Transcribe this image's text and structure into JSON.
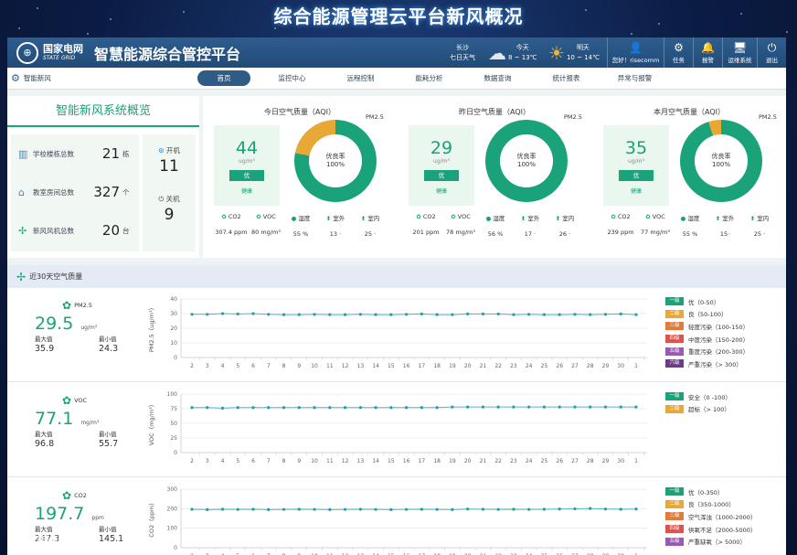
{
  "page_title": "综合能源管理云平台新风概况",
  "header": {
    "brand_cn": "国家电网",
    "brand_en": "STATE GRID",
    "app_title": "智慧能源综合管控平台",
    "city": "长沙",
    "weather_label": "七日天气",
    "today": {
      "label": "今天",
      "temp": "8 ~ 13℃"
    },
    "tomorrow": {
      "label": "明天",
      "temp": "10 ~ 14℃"
    },
    "user": "您好！risecomm",
    "tools": [
      "任务",
      "报警",
      "运维系统",
      "退出"
    ]
  },
  "nav": {
    "current": "智能新风",
    "tabs": [
      "首页",
      "监控中心",
      "远程控制",
      "能耗分析",
      "数据查询",
      "统计报表",
      "异常与报警"
    ]
  },
  "overview": {
    "title": "智能新风系统概览",
    "rows": [
      {
        "label": "学校楼栋总数",
        "value": "21",
        "unit": "栋"
      },
      {
        "label": "教室房间总数",
        "value": "327",
        "unit": "个"
      },
      {
        "label": "新风风机总数",
        "value": "20",
        "unit": "台"
      }
    ],
    "on_label": "开机",
    "on_value": "11",
    "off_label": "关机",
    "off_value": "9"
  },
  "aqi_cards": [
    {
      "title": "今日空气质量（AQI）",
      "value": "44",
      "unit": "ug/m³",
      "level": "优",
      "health": "健康",
      "pm": "PM2.5",
      "rate_label": "优良率",
      "rate": "100%",
      "donut_fraction": 0.78,
      "stats": [
        {
          "k": "CO2",
          "v": "307.4 ppm"
        },
        {
          "k": "VOC",
          "v": "80 mg/m³"
        },
        {
          "k": "湿度",
          "v": "55 %"
        },
        {
          "k": "室外",
          "v": "13 ·"
        },
        {
          "k": "室内",
          "v": "25 ·"
        }
      ]
    },
    {
      "title": "昨日空气质量（AQI）",
      "value": "29",
      "unit": "ug/m³",
      "level": "优",
      "health": "健康",
      "pm": "PM2.5",
      "rate_label": "优良率",
      "rate": "100%",
      "donut_fraction": 1.0,
      "stats": [
        {
          "k": "CO2",
          "v": "201 ppm"
        },
        {
          "k": "VOC",
          "v": "78 mg/m³"
        },
        {
          "k": "湿度",
          "v": "56 %"
        },
        {
          "k": "室外",
          "v": "17 ·"
        },
        {
          "k": "室内",
          "v": "26 ·"
        }
      ]
    },
    {
      "title": "本月空气质量（AQI）",
      "value": "35",
      "unit": "ug/m³",
      "level": "优",
      "health": "健康",
      "pm": "PM2.5",
      "rate_label": "优良率",
      "rate": "100%",
      "donut_fraction": 0.95,
      "stats": [
        {
          "k": "CO2",
          "v": "239 ppm"
        },
        {
          "k": "VOC",
          "v": "77 mg/m³"
        },
        {
          "k": "湿度",
          "v": "55 %"
        },
        {
          "k": "室外",
          "v": "15·"
        },
        {
          "k": "室内",
          "v": "25 ·"
        }
      ]
    }
  ],
  "trend_title": "近30天空气质量",
  "trends": [
    {
      "name": "PM2.5",
      "value": "29.5",
      "unit": "ug/m³",
      "max_label": "最大值",
      "max": "35.9",
      "min_label": "最小值",
      "min": "24.3",
      "legend": [
        {
          "tag": "一级",
          "text": "优（0-50）"
        },
        {
          "tag": "二级",
          "text": "良（50-100）"
        },
        {
          "tag": "三级",
          "text": "轻度污染（100-150）"
        },
        {
          "tag": "四级",
          "text": "中度污染（150-200）"
        },
        {
          "tag": "五级",
          "text": "重度污染（200-300）"
        },
        {
          "tag": "六级",
          "text": "严重污染（> 300）"
        }
      ]
    },
    {
      "name": "VOC",
      "value": "77.1",
      "unit": "mg/m³",
      "max_label": "最大值",
      "max": "96.8",
      "min_label": "最小值",
      "min": "55.7",
      "legend": [
        {
          "tag": "一级",
          "text": "安全（0 -100）"
        },
        {
          "tag": "二级",
          "text": "超标（> 100）"
        }
      ]
    },
    {
      "name": "CO2",
      "value": "197.7",
      "unit": "ppm",
      "max_label": "最大值",
      "max": "247.3",
      "min_label": "最小值",
      "min": "145.1",
      "legend": [
        {
          "tag": "一级",
          "text": "优（0-350）"
        },
        {
          "tag": "二级",
          "text": "良（350-1000）"
        },
        {
          "tag": "三级",
          "text": "空气浑浊（1000-2000）"
        },
        {
          "tag": "四级",
          "text": "供氧不足（2000-5000）"
        },
        {
          "tag": "五级",
          "text": "严重缺氧（> 5000）"
        }
      ]
    }
  ],
  "legend_colors": [
    "#1aa37a",
    "#e8a838",
    "#e07b39",
    "#d9534f",
    "#9b59b6",
    "#6d3a8a"
  ],
  "watermark": "大数据可视化",
  "chart_data": [
    {
      "type": "line",
      "ylabel": "PM2.5（ug/m³）",
      "ylim": [
        0,
        40
      ],
      "yticks": [
        0,
        10,
        20,
        30,
        40
      ],
      "categories": [
        "2",
        "3",
        "4",
        "5",
        "6",
        "7",
        "8",
        "9",
        "10",
        "11",
        "12",
        "13",
        "14",
        "15",
        "16",
        "17",
        "18",
        "19",
        "20",
        "21",
        "22",
        "23",
        "24",
        "25",
        "26",
        "27",
        "28",
        "29",
        "30",
        "1"
      ],
      "values": [
        29.5,
        29.5,
        30,
        29.8,
        30,
        29.5,
        29.3,
        29.3,
        29.5,
        29.3,
        29.3,
        29.5,
        29.3,
        29.3,
        29.5,
        29.8,
        29.3,
        29.3,
        29.8,
        29.8,
        29.8,
        29.3,
        29.5,
        29.3,
        29.3,
        29.5,
        29.3,
        29.5,
        29.8,
        29.3
      ]
    },
    {
      "type": "line",
      "ylabel": "VOC（mg/m³）",
      "ylim": [
        0,
        100
      ],
      "yticks": [
        0,
        25,
        50,
        75,
        100
      ],
      "categories": [
        "2",
        "3",
        "4",
        "5",
        "6",
        "7",
        "8",
        "9",
        "10",
        "11",
        "12",
        "13",
        "14",
        "15",
        "16",
        "17",
        "18",
        "19",
        "20",
        "21",
        "22",
        "23",
        "24",
        "25",
        "26",
        "27",
        "28",
        "29",
        "30",
        "1"
      ],
      "values": [
        77,
        77,
        76,
        77,
        77,
        77,
        77,
        77,
        77,
        77,
        77,
        77,
        77,
        77,
        77,
        77,
        77,
        78,
        78,
        78,
        78,
        78,
        78,
        78,
        78,
        78,
        78,
        78,
        78,
        78
      ]
    },
    {
      "type": "line",
      "ylabel": "CO2（ppm）",
      "ylim": [
        0,
        300
      ],
      "yticks": [
        0,
        100,
        200,
        300
      ],
      "categories": [
        "2",
        "3",
        "4",
        "5",
        "6",
        "7",
        "8",
        "9",
        "10",
        "11",
        "12",
        "13",
        "14",
        "15",
        "16",
        "17",
        "18",
        "19",
        "20",
        "21",
        "22",
        "23",
        "24",
        "25",
        "26",
        "27",
        "28",
        "29",
        "30",
        "1"
      ],
      "values": [
        197,
        195,
        197,
        196,
        197,
        195,
        196,
        197,
        196,
        195,
        196,
        197,
        196,
        195,
        196,
        197,
        196,
        195,
        198,
        197,
        196,
        197,
        196,
        197,
        198,
        199,
        201,
        198,
        197,
        198
      ]
    }
  ]
}
